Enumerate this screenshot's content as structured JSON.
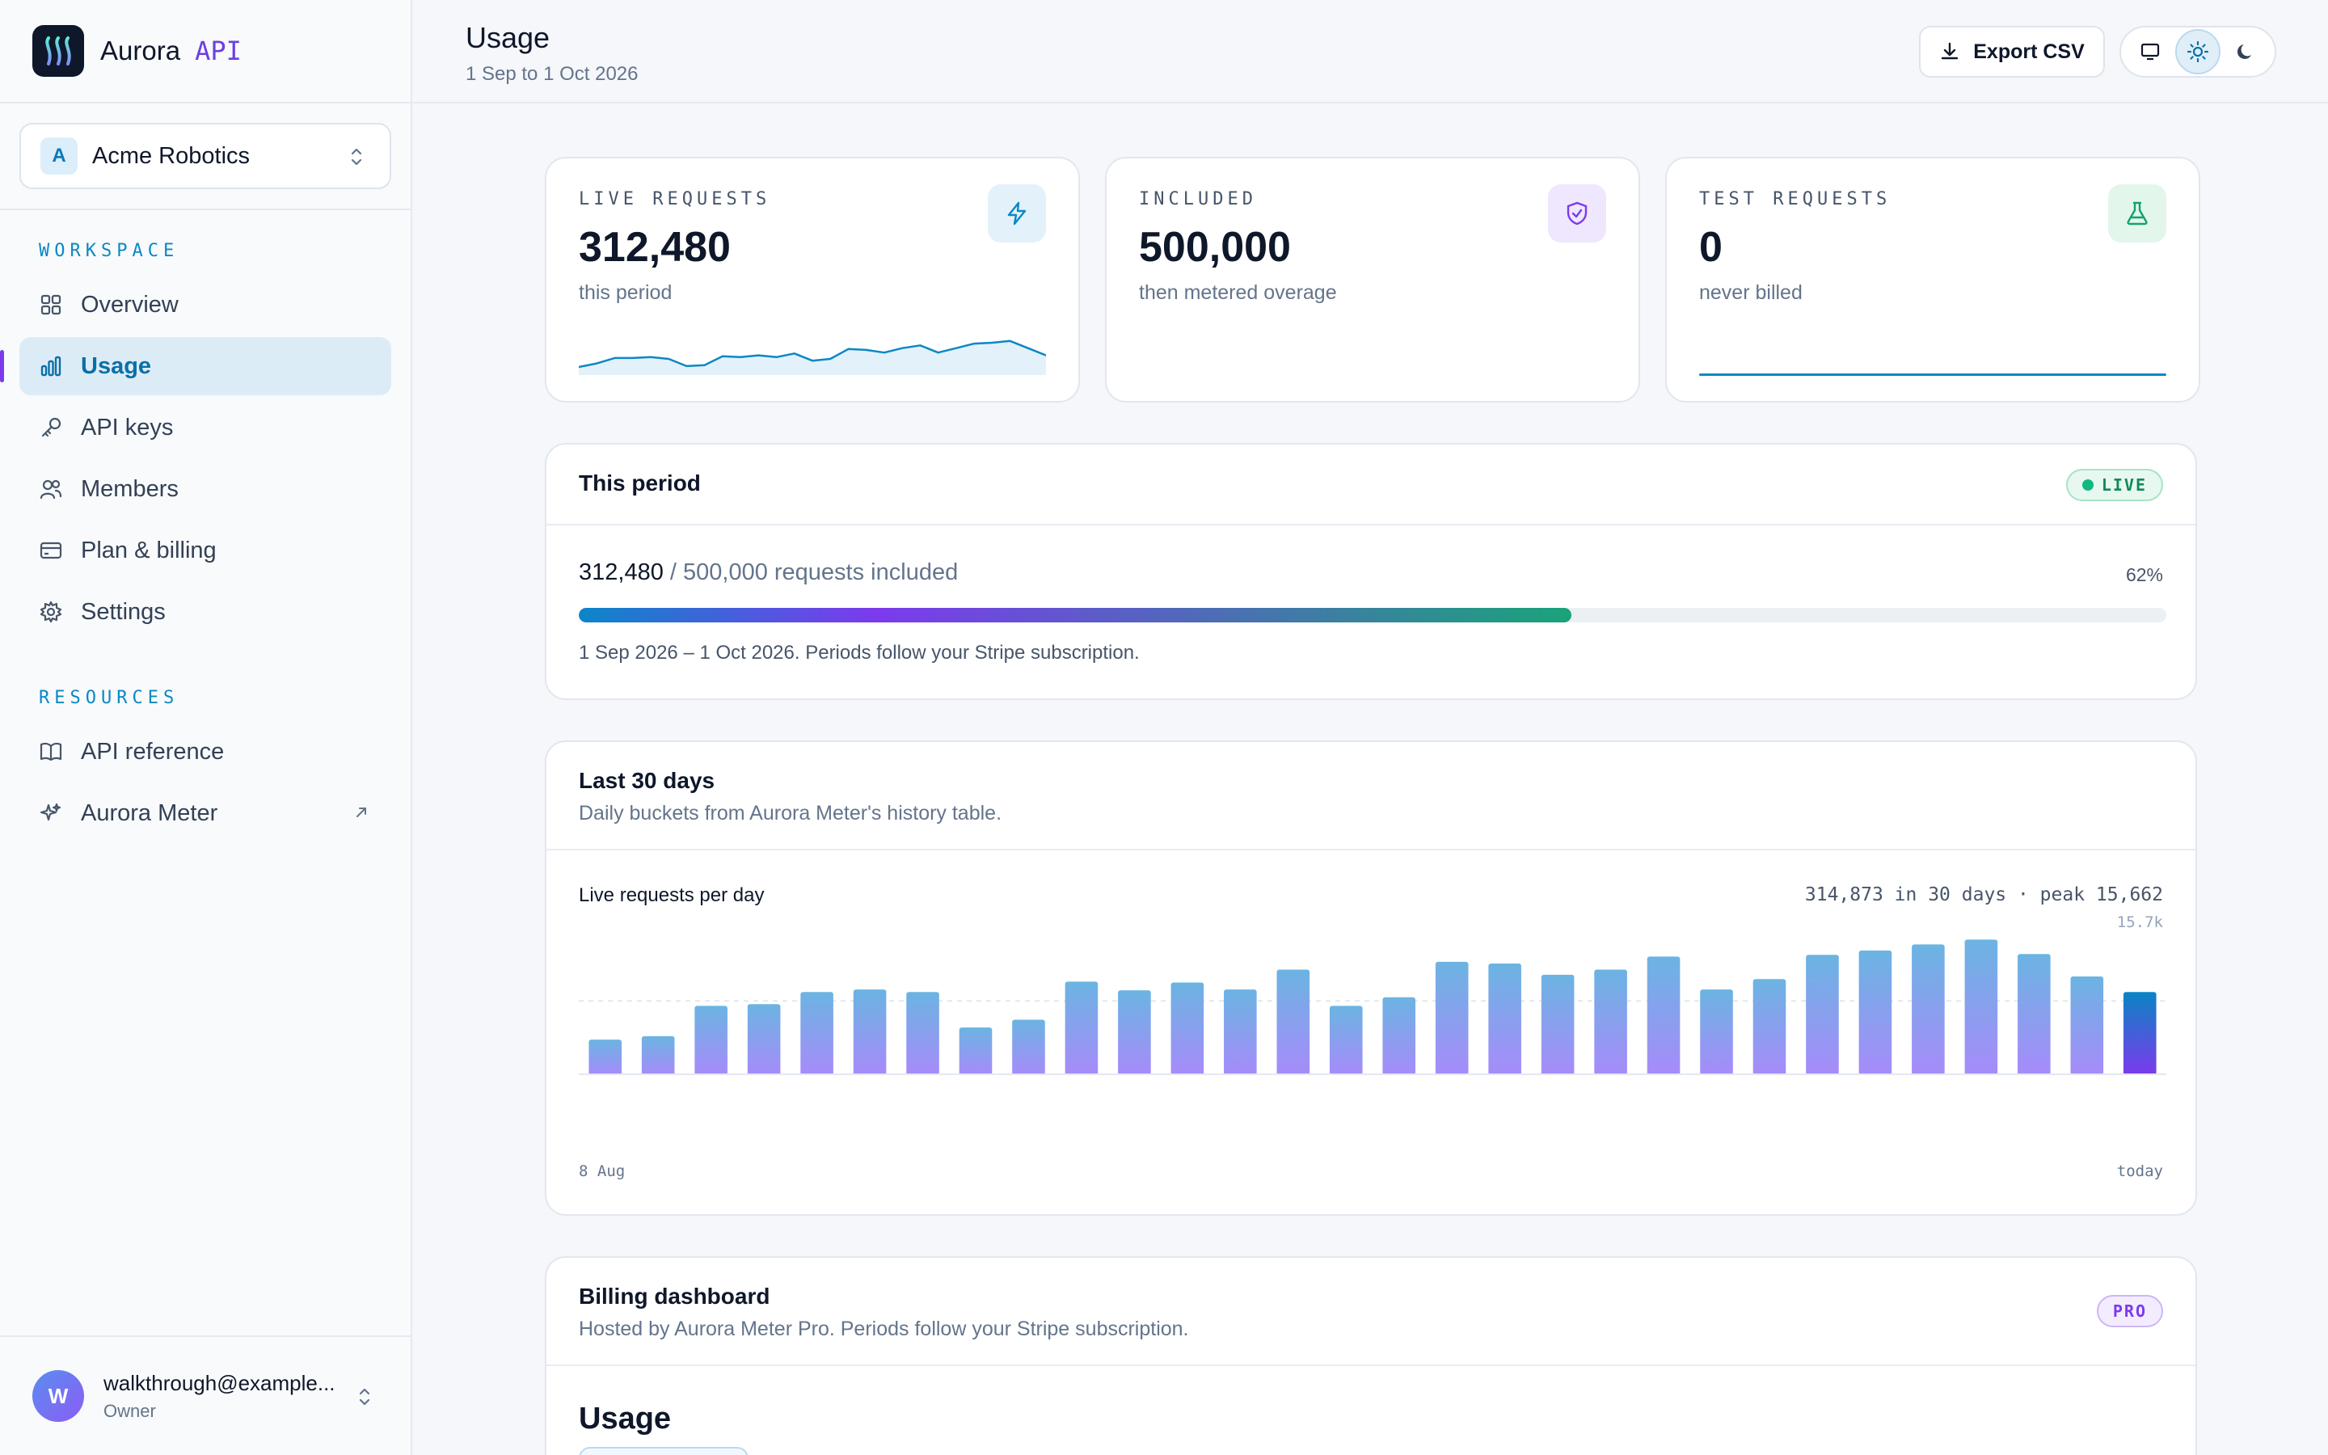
{
  "brand": {
    "name": "Aurora",
    "suffix": "API"
  },
  "org": {
    "initial": "A",
    "name": "Acme Robotics"
  },
  "sidebar": {
    "workspace_label": "WORKSPACE",
    "workspace_items": [
      {
        "label": "Overview",
        "icon": "grid-icon"
      },
      {
        "label": "Usage",
        "icon": "bar-chart-icon",
        "active": true
      },
      {
        "label": "API keys",
        "icon": "key-icon"
      },
      {
        "label": "Members",
        "icon": "users-icon"
      },
      {
        "label": "Plan & billing",
        "icon": "credit-card-icon"
      },
      {
        "label": "Settings",
        "icon": "gear-icon"
      }
    ],
    "resources_label": "RESOURCES",
    "resource_items": [
      {
        "label": "API reference",
        "icon": "book-icon"
      },
      {
        "label": "Aurora Meter",
        "icon": "sparkle-icon",
        "external": true
      }
    ]
  },
  "user": {
    "initial": "W",
    "email": "walkthrough@example...",
    "role": "Owner"
  },
  "header": {
    "title": "Usage",
    "subtitle": "1 Sep to 1 Oct 2026",
    "export_label": "Export CSV",
    "theme_selected": "light"
  },
  "stats": [
    {
      "label": "LIVE REQUESTS",
      "value": "312,480",
      "sub": "this period",
      "icon": "bolt-icon"
    },
    {
      "label": "INCLUDED",
      "value": "500,000",
      "sub": "then metered overage",
      "icon": "shield-check-icon"
    },
    {
      "label": "TEST REQUESTS",
      "value": "0",
      "sub": "never billed",
      "icon": "flask-icon"
    }
  ],
  "period": {
    "title": "This period",
    "badge": "LIVE",
    "used": "312,480",
    "included_text": "/ 500,000 requests included",
    "percent_label": "62%",
    "percent": 62.5,
    "note": "1 Sep 2026 – 1 Oct 2026. Periods follow your Stripe subscription."
  },
  "last30": {
    "title": "Last 30 days",
    "desc": "Daily buckets from Aurora Meter's history table.",
    "chart_label": "Live requests per day",
    "summary": "314,873 in 30 days · peak 15,662",
    "max_label": "15.7k",
    "x_start": "8 Aug",
    "x_end": "today"
  },
  "billing": {
    "title": "Billing dashboard",
    "desc": "Hosted by Aurora Meter Pro. Periods follow your Stripe subscription.",
    "badge": "PRO",
    "section_title": "Usage"
  },
  "colors": {
    "accent": "#0b6fa8",
    "purple": "#7c3aed",
    "green": "#10b981"
  },
  "chart_data": [
    {
      "type": "bar",
      "title": "Live requests per day",
      "x": [
        "8 Aug",
        "",
        "",
        "",
        "",
        "",
        "",
        "",
        "",
        "",
        "",
        "",
        "",
        "",
        "",
        "",
        "",
        "",
        "",
        "",
        "",
        "",
        "",
        "",
        "",
        "",
        "",
        "",
        "",
        "today"
      ],
      "values": [
        4100,
        4500,
        8000,
        8200,
        9600,
        9900,
        9600,
        5500,
        6400,
        10800,
        9800,
        10700,
        9900,
        12200,
        8000,
        9000,
        13100,
        12900,
        11600,
        12200,
        13700,
        9900,
        11100,
        13900,
        14400,
        15100,
        15662,
        14000,
        11400,
        9600
      ],
      "ylim": [
        0,
        15700
      ],
      "highlight_last": true
    },
    {
      "type": "line",
      "title": "",
      "values": [
        9,
        13,
        19,
        19,
        20,
        18,
        10,
        11,
        21,
        20,
        22,
        20,
        24,
        16,
        18,
        29,
        28,
        25,
        30,
        33,
        25,
        30,
        35,
        36,
        38,
        30,
        22
      ],
      "ylim": [
        0,
        45
      ]
    }
  ]
}
